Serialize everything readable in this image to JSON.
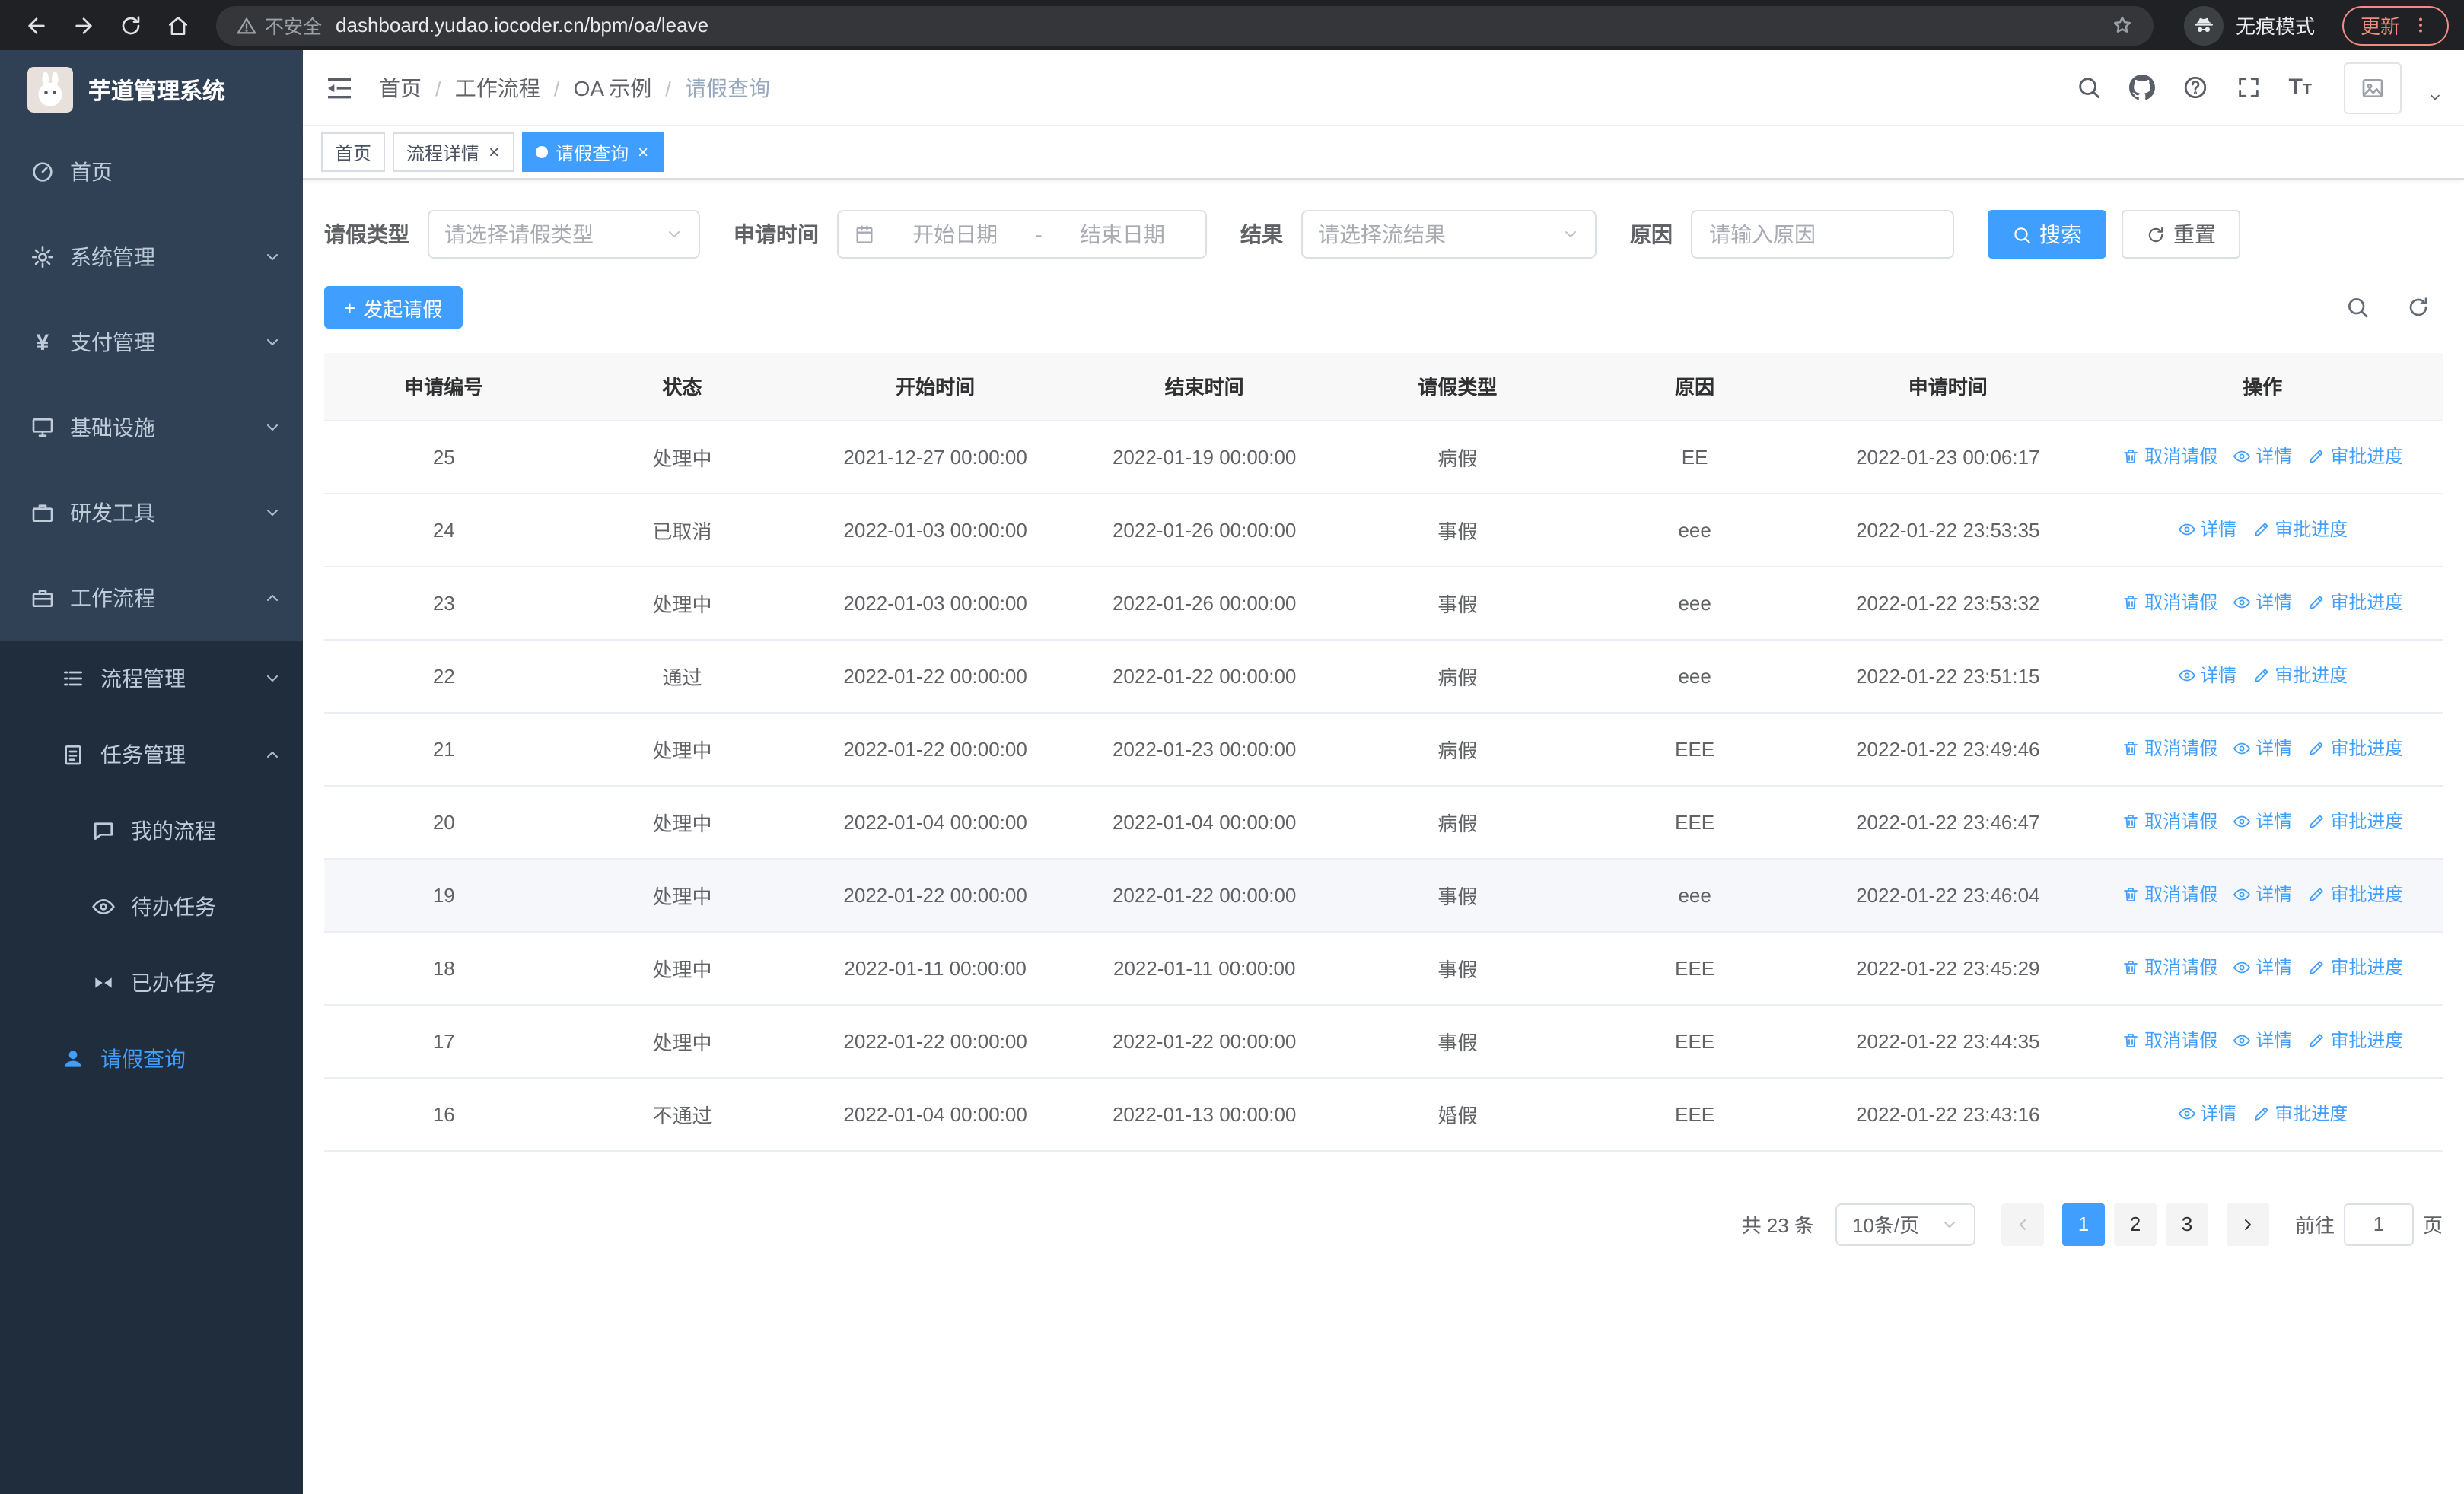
{
  "colors": {
    "accent": "#409eff",
    "sidebar_bg": "#304156",
    "sidebar_submenu_bg": "#1f2d3d",
    "chrome_bg": "#202124",
    "update_pill": "#f28b82",
    "table_header_bg": "#f8f8f9"
  },
  "browser": {
    "security_warning": "不安全",
    "url": "dashboard.yudao.iocoder.cn/bpm/oa/leave",
    "incognito_label": "无痕模式",
    "update_button": "更新"
  },
  "sidebar": {
    "logo_title": "芋道管理系统",
    "items": [
      {
        "label": "首页"
      },
      {
        "label": "系统管理"
      },
      {
        "label": "支付管理"
      },
      {
        "label": "基础设施"
      },
      {
        "label": "研发工具"
      },
      {
        "label": "工作流程"
      }
    ],
    "sub_items": [
      {
        "label": "流程管理"
      },
      {
        "label": "任务管理"
      }
    ],
    "task_children": [
      {
        "label": "我的流程"
      },
      {
        "label": "待办任务"
      },
      {
        "label": "已办任务"
      }
    ],
    "active_item": {
      "label": "请假查询"
    }
  },
  "navbar": {
    "breadcrumbs": [
      "首页",
      "工作流程",
      "OA 示例",
      "请假查询"
    ]
  },
  "tags": [
    {
      "label": "首页",
      "closable": false,
      "active": false
    },
    {
      "label": "流程详情",
      "closable": true,
      "active": false
    },
    {
      "label": "请假查询",
      "closable": true,
      "active": true
    }
  ],
  "filters": {
    "leave_type_label": "请假类型",
    "leave_type_placeholder": "请选择请假类型",
    "apply_time_label": "申请时间",
    "start_date_placeholder": "开始日期",
    "range_separator": "-",
    "end_date_placeholder": "结束日期",
    "result_label": "结果",
    "result_placeholder": "请选择流结果",
    "reason_label": "原因",
    "reason_placeholder": "请输入原因",
    "search_button": "搜索",
    "reset_button": "重置"
  },
  "toolbar": {
    "create_button": "发起请假"
  },
  "table": {
    "columns": [
      "申请编号",
      "状态",
      "开始时间",
      "结束时间",
      "请假类型",
      "原因",
      "申请时间",
      "操作"
    ],
    "actions": {
      "cancel": "取消请假",
      "detail": "详情",
      "progress": "审批进度"
    },
    "rows": [
      {
        "id": "25",
        "status": "处理中",
        "start": "2021-12-27 00:00:00",
        "end": "2022-01-19 00:00:00",
        "type": "病假",
        "reason": "EE",
        "apply": "2022-01-23 00:06:17",
        "cancellable": true,
        "hover": false
      },
      {
        "id": "24",
        "status": "已取消",
        "start": "2022-01-03 00:00:00",
        "end": "2022-01-26 00:00:00",
        "type": "事假",
        "reason": "eee",
        "apply": "2022-01-22 23:53:35",
        "cancellable": false,
        "hover": false
      },
      {
        "id": "23",
        "status": "处理中",
        "start": "2022-01-03 00:00:00",
        "end": "2022-01-26 00:00:00",
        "type": "事假",
        "reason": "eee",
        "apply": "2022-01-22 23:53:32",
        "cancellable": true,
        "hover": false
      },
      {
        "id": "22",
        "status": "通过",
        "start": "2022-01-22 00:00:00",
        "end": "2022-01-22 00:00:00",
        "type": "病假",
        "reason": "eee",
        "apply": "2022-01-22 23:51:15",
        "cancellable": false,
        "hover": false
      },
      {
        "id": "21",
        "status": "处理中",
        "start": "2022-01-22 00:00:00",
        "end": "2022-01-23 00:00:00",
        "type": "病假",
        "reason": "EEE",
        "apply": "2022-01-22 23:49:46",
        "cancellable": true,
        "hover": false
      },
      {
        "id": "20",
        "status": "处理中",
        "start": "2022-01-04 00:00:00",
        "end": "2022-01-04 00:00:00",
        "type": "病假",
        "reason": "EEE",
        "apply": "2022-01-22 23:46:47",
        "cancellable": true,
        "hover": false
      },
      {
        "id": "19",
        "status": "处理中",
        "start": "2022-01-22 00:00:00",
        "end": "2022-01-22 00:00:00",
        "type": "事假",
        "reason": "eee",
        "apply": "2022-01-22 23:46:04",
        "cancellable": true,
        "hover": true
      },
      {
        "id": "18",
        "status": "处理中",
        "start": "2022-01-11 00:00:00",
        "end": "2022-01-11 00:00:00",
        "type": "事假",
        "reason": "EEE",
        "apply": "2022-01-22 23:45:29",
        "cancellable": true,
        "hover": false
      },
      {
        "id": "17",
        "status": "处理中",
        "start": "2022-01-22 00:00:00",
        "end": "2022-01-22 00:00:00",
        "type": "事假",
        "reason": "EEE",
        "apply": "2022-01-22 23:44:35",
        "cancellable": true,
        "hover": false
      },
      {
        "id": "16",
        "status": "不通过",
        "start": "2022-01-04 00:00:00",
        "end": "2022-01-13 00:00:00",
        "type": "婚假",
        "reason": "EEE",
        "apply": "2022-01-22 23:43:16",
        "cancellable": false,
        "hover": false
      }
    ]
  },
  "pagination": {
    "total": "共 23 条",
    "page_size": "10条/页",
    "pages": [
      "1",
      "2",
      "3"
    ],
    "active_page": "1",
    "goto_label": "前往",
    "goto_value": "1",
    "goto_suffix": "页"
  }
}
